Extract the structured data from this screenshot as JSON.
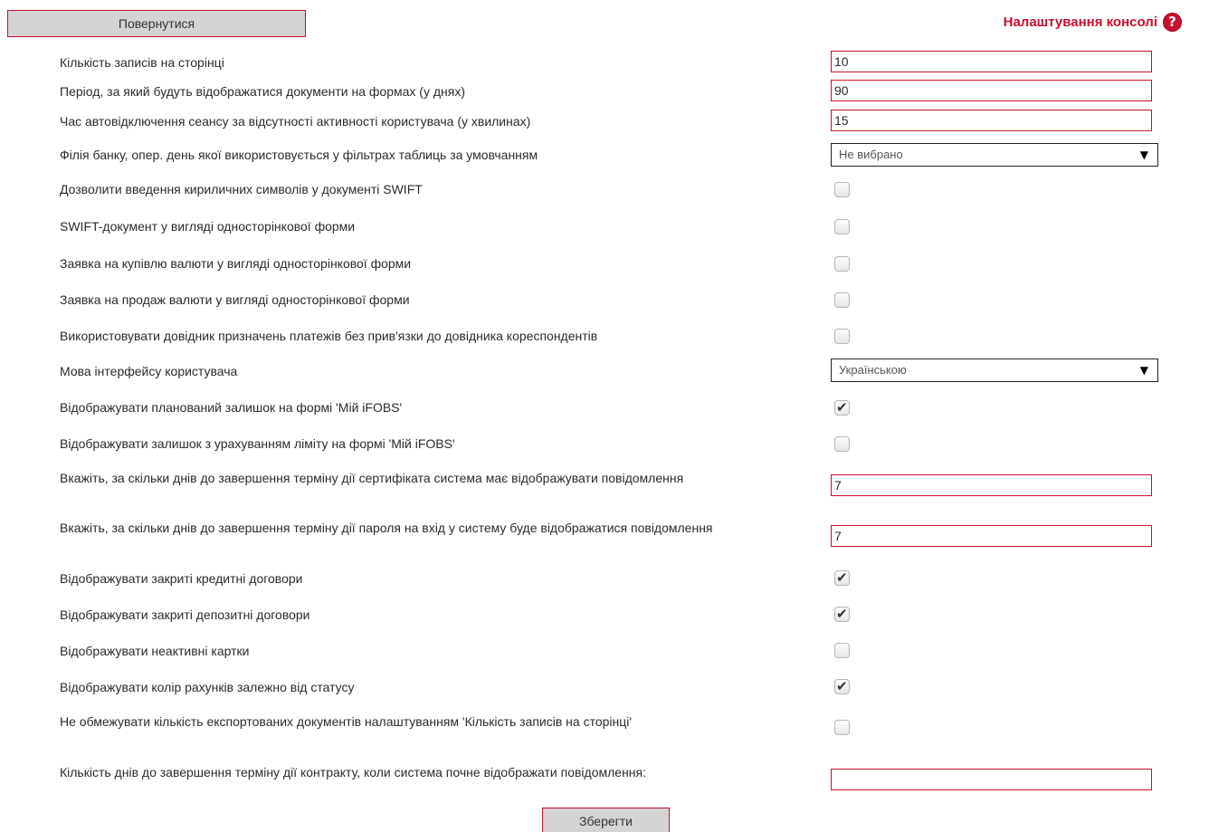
{
  "header": {
    "back_label": "Повернутися",
    "title": "Налаштування консолі",
    "help_glyph": "?"
  },
  "settings": [
    {
      "label": "Кількість записів на сторінці",
      "type": "text",
      "value": "10"
    },
    {
      "label": "Період, за який будуть відображатися документи на формах (у днях)",
      "type": "text",
      "value": "90"
    },
    {
      "label": "Час автовідключення сеансу за відсутності активності користувача (у хвилинах)",
      "type": "text",
      "value": "15"
    },
    {
      "label": "Філія банку, опер. день якої використовується у фільтрах таблиць за умовчанням",
      "type": "select",
      "value": "Не вибрано"
    },
    {
      "label": "Дозволити введення кириличних символів у документі SWIFT",
      "type": "checkbox",
      "checked": false
    },
    {
      "label": "SWIFT-документ у вигляді односторінкової форми",
      "type": "checkbox",
      "checked": false
    },
    {
      "label": "Заявка на купівлю валюти у вигляді односторінкової форми",
      "type": "checkbox",
      "checked": false
    },
    {
      "label": "Заявка на продаж валюти у вигляді односторінкової форми",
      "type": "checkbox",
      "checked": false
    },
    {
      "label": "Використовувати довідник призначень платежів без прив'язки до довідника кореспондентів",
      "type": "checkbox",
      "checked": false
    },
    {
      "label": "Мова інтерфейсу користувача",
      "type": "select",
      "value": "Українською"
    },
    {
      "label": "Відображувати планований залишок на формі 'Мій iFOBS'",
      "type": "checkbox",
      "checked": true
    },
    {
      "label": "Відображувати залишок з урахуванням ліміту на формі 'Мій iFOBS'",
      "type": "checkbox",
      "checked": false
    },
    {
      "label": "Вкажіть, за скільки днів до завершення терміну дії сертифіката система має відображувати повідомлення",
      "type": "text",
      "value": "7"
    },
    {
      "label": "Вкажіть, за скільки днів до завершення терміну дії пароля на вхід у систему буде відображатися повідомлення",
      "type": "text",
      "value": "7"
    },
    {
      "label": "Відображувати закриті кредитні договори",
      "type": "checkbox",
      "checked": true
    },
    {
      "label": "Відображувати закриті депозитні договори",
      "type": "checkbox",
      "checked": true
    },
    {
      "label": "Відображувати неактивні картки",
      "type": "checkbox",
      "checked": false
    },
    {
      "label": "Відображувати колір рахунків залежно від статусу",
      "type": "checkbox",
      "checked": true
    },
    {
      "label": "Не обмежувати кількість експортованих документів налаштуванням 'Кількість записів на сторінці'",
      "type": "checkbox",
      "checked": false
    },
    {
      "label": "Кількість днів до завершення терміну дії контракту, коли система почне відображати повідомлення:",
      "type": "text",
      "value": ""
    }
  ],
  "footer": {
    "save_label": "Зберегти"
  },
  "colors": {
    "accent": "#c8102e",
    "button_bg": "#d4d4d4"
  }
}
